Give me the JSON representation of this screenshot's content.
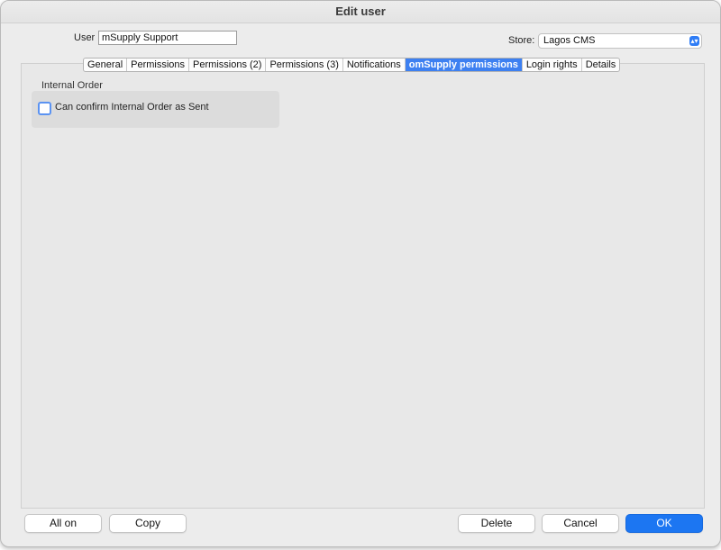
{
  "window": {
    "title": "Edit user"
  },
  "user": {
    "label": "User",
    "value": "mSupply Support"
  },
  "store": {
    "label": "Store:",
    "value": "Lagos CMS"
  },
  "tabs": [
    {
      "label": "General"
    },
    {
      "label": "Permissions"
    },
    {
      "label": "Permissions (2)"
    },
    {
      "label": "Permissions (3)"
    },
    {
      "label": "Notifications"
    },
    {
      "label": "omSupply permissions",
      "active": true
    },
    {
      "label": "Login rights"
    },
    {
      "label": "Details"
    }
  ],
  "group": {
    "title": "Internal Order",
    "checkbox_label": "Can confirm Internal Order as Sent",
    "checked": false
  },
  "buttons": {
    "all_on": "All on",
    "copy": "Copy",
    "delete": "Delete",
    "cancel": "Cancel",
    "ok": "OK"
  },
  "colors": {
    "accent": "#1c76f2",
    "active_tab": "#3d80f1"
  }
}
